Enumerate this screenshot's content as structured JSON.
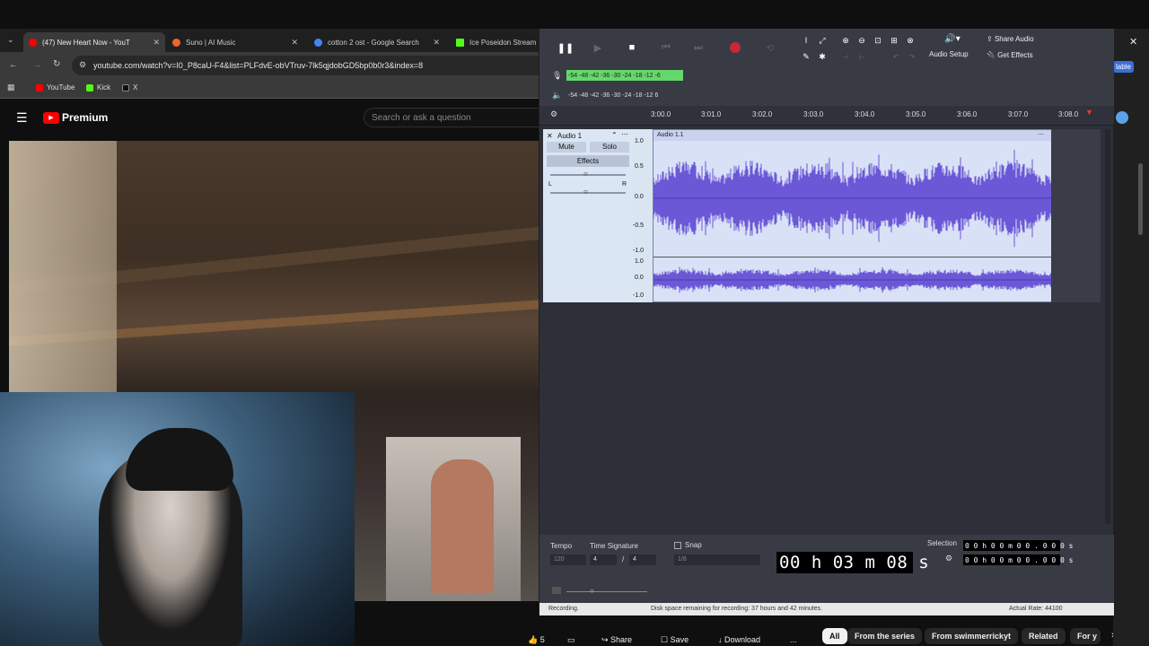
{
  "browser": {
    "tabs": [
      {
        "title": "(47) New Heart Now - YouT",
        "color": "#ff0000"
      },
      {
        "title": "Suno | AI Music",
        "color": "#f0642a"
      },
      {
        "title": "cotton 2 ost - Google Search",
        "color": "#4285f4"
      },
      {
        "title": "Ice Poseidon Stream",
        "color": "#53fc18"
      }
    ],
    "url": "youtube.com/watch?v=I0_P8caU-F4&list=PLFdvE-obVTruv-7lk5qjdobGD5bp0b0r3&index=8",
    "bookmarks": [
      {
        "label": "YouTube",
        "color": "#ff0000"
      },
      {
        "label": "Kick",
        "color": "#53fc18"
      },
      {
        "label": "X",
        "color": "#000000"
      }
    ],
    "right_partial": "lable"
  },
  "youtube": {
    "logo_label": "Premium",
    "search_placeholder": "Search or ask a question",
    "actions": {
      "likes": "5",
      "share": "Share",
      "save": "Save",
      "download": "Download",
      "more": "..."
    },
    "chips": [
      "All",
      "From the series",
      "From swimmerrickyt",
      "Related",
      "For y"
    ]
  },
  "audacity": {
    "meter_record": "-54 -48 -42 -36 -30 -24 -18 -12  -6",
    "meter_play": "-54 -48 -42 -36 -30 -24 -18 -12  6",
    "audio_setup": "Audio Setup",
    "share_audio": "Share Audio",
    "get_effects": "Get Effects",
    "timeline": [
      "3:00.0",
      "3:01.0",
      "3:02.0",
      "3:03.0",
      "3:04.0",
      "3:05.0",
      "3:06.0",
      "3:07.0",
      "3:08.0"
    ],
    "track": {
      "name": "Audio 1",
      "clip_name": "Audio 1.1",
      "mute": "Mute",
      "solo": "Solo",
      "effects": "Effects",
      "pan_left": "L",
      "pan_right": "R",
      "scale_top": [
        "1.0",
        "0.5",
        "0.0",
        "-0.5",
        "-1.0"
      ],
      "scale_bottom": [
        "1.0",
        "0.0",
        "-1.0"
      ]
    },
    "tempo_label": "Tempo",
    "tempo_value": "120",
    "time_sig_label": "Time Signature",
    "time_sig_num": "4",
    "time_sig_den": "4",
    "snap_label": "Snap",
    "snap_value": "1/8",
    "time_display": "00 h 03 m 08 s",
    "selection_label": "Selection",
    "selection_start": "0 0 h 0 0 m 0 0 . 0 0 0 s",
    "selection_end": "0 0 h 0 0 m 0 0 . 0 0 0 s",
    "status_left": "Recording.",
    "status_mid": "Disk space remaining for recording: 37 hours and 42 minutes.",
    "status_right": "Actual Rate: 44100"
  }
}
